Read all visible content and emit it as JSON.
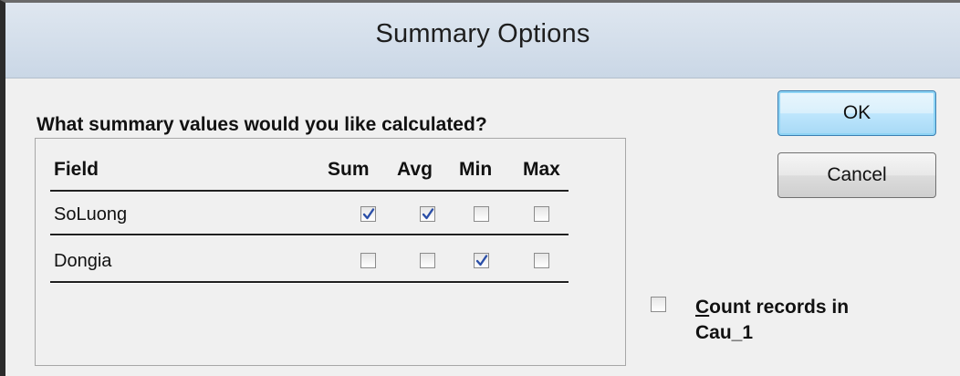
{
  "dialog": {
    "title": "Summary Options",
    "prompt": "What summary values would you like calculated?"
  },
  "table": {
    "headers": {
      "field": "Field",
      "sum": "Sum",
      "avg": "Avg",
      "min": "Min",
      "max": "Max"
    },
    "rows": [
      {
        "field": "SoLuong",
        "sum": true,
        "avg": true,
        "min": false,
        "max": false
      },
      {
        "field": "Dongia",
        "sum": false,
        "avg": false,
        "min": true,
        "max": false
      }
    ]
  },
  "buttons": {
    "ok": "OK",
    "cancel": "Cancel"
  },
  "count_records": {
    "checked": false,
    "mnemonic": "C",
    "label_rest_line1": "ount records in",
    "label_line2": "Cau_1"
  },
  "colors": {
    "titlebar": "#d3deea",
    "dialog_bg": "#f0f0f0",
    "check": "#2b4fa8",
    "default_button_border": "#3c7fb1"
  }
}
